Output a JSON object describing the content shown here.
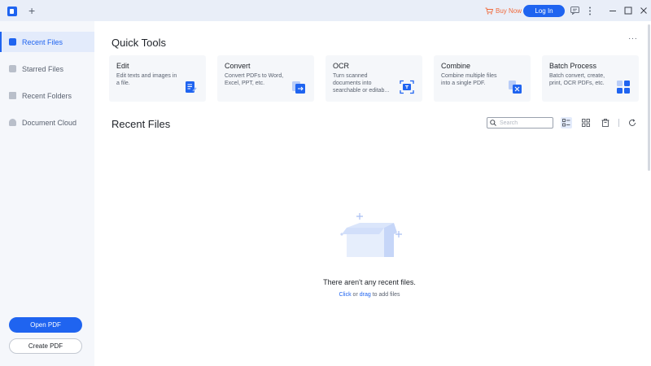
{
  "titlebar": {
    "new_tab": "+",
    "buy_now": "Buy Now",
    "login": "Log In",
    "icons": [
      "logo-icon",
      "cart-icon",
      "chat-icon",
      "more-icon",
      "minimize-icon",
      "maximize-icon",
      "close-icon"
    ]
  },
  "sidebar": {
    "items": [
      {
        "label": "Recent Files",
        "icon": "recent-files-icon",
        "active": true
      },
      {
        "label": "Starred Files",
        "icon": "star-icon",
        "active": false
      },
      {
        "label": "Recent Folders",
        "icon": "folder-icon",
        "active": false
      },
      {
        "label": "Document Cloud",
        "icon": "cloud-icon",
        "active": false
      }
    ],
    "open_pdf": "Open PDF",
    "create_pdf": "Create PDF"
  },
  "quick_tools": {
    "title": "Quick Tools",
    "more": "···",
    "tools": [
      {
        "name": "Edit",
        "desc": "Edit texts and images in a file.",
        "icon": "edit-document-icon"
      },
      {
        "name": "Convert",
        "desc": "Convert PDFs to Word, Excel, PPT, etc.",
        "icon": "convert-icon"
      },
      {
        "name": "OCR",
        "desc": "Turn scanned documents into searchable or editab...",
        "icon": "ocr-scan-icon"
      },
      {
        "name": "Combine",
        "desc": "Combine multiple files into a single PDF.",
        "icon": "combine-icon"
      },
      {
        "name": "Batch Process",
        "desc": "Batch convert, create, print, OCR PDFs, etc.",
        "icon": "batch-process-icon"
      }
    ]
  },
  "recent": {
    "title": "Recent Files",
    "search_placeholder": "Search",
    "empty_message": "There aren't any recent files.",
    "hint_click": "Click",
    "hint_or": " or ",
    "hint_drag": "drag",
    "hint_rest": " to add files"
  },
  "colors": {
    "accent": "#1f64f0",
    "buy_now": "#f06a3c"
  }
}
